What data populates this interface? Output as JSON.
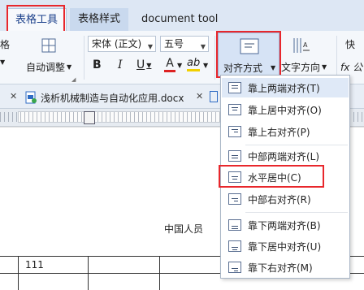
{
  "tabs": {
    "table_tools": "表格工具",
    "table_style": "表格样式",
    "document_tool": "document tool"
  },
  "ribbon": {
    "left_cut": "格",
    "auto_adjust": "自动调整",
    "font_name": "宋体 (正文)",
    "font_size": "五号",
    "bold": "B",
    "italic": "I",
    "underline": "U",
    "font_color": "A",
    "highlight": "ab",
    "align": "对齐方式",
    "text_direction": "文字方向",
    "formula": "fx 公",
    "right_cut": "快"
  },
  "doc_tab": {
    "filename": "浅析机械制造与自动化应用.docx"
  },
  "page": {
    "center_text": "中国人员",
    "cell_text": "111"
  },
  "menu": {
    "items": [
      "靠上两端对齐(T)",
      "靠上居中对齐(O)",
      "靠上右对齐(P)",
      "中部两端对齐(L)",
      "水平居中(C)",
      "中部右对齐(R)",
      "靠下两端对齐(B)",
      "靠下居中对齐(U)",
      "靠下右对齐(M)"
    ]
  },
  "colors": {
    "highlight_red": "#e8272c",
    "accent_blue": "#1a3f8a",
    "font_color_red": "#d22",
    "highlight_yellow": "#f2d000"
  }
}
